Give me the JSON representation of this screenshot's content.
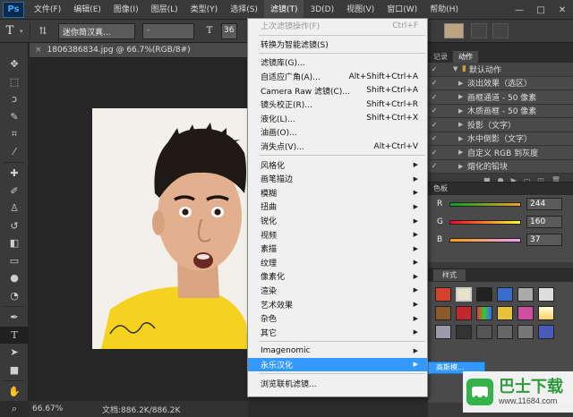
{
  "app": {
    "logo": "Ps"
  },
  "menubar": {
    "items": [
      "文件(F)",
      "编辑(E)",
      "图像(I)",
      "图层(L)",
      "类型(Y)",
      "选择(S)",
      "滤镜(T)",
      "3D(D)",
      "视图(V)",
      "窗口(W)",
      "帮助(H)"
    ],
    "active_index": 6,
    "window_controls": [
      "—",
      "□",
      "✕"
    ]
  },
  "options": {
    "tool_glyph": "T",
    "font_family": "迷你简汉真...",
    "font_style": "-",
    "font_size": "36"
  },
  "toolbar": {
    "tools": [
      "move-tool",
      "marquee-tool",
      "lasso-tool",
      "quick-select-tool",
      "crop-tool",
      "eyedropper-tool",
      "healing-brush-tool",
      "brush-tool",
      "clone-stamp-tool",
      "history-brush-tool",
      "eraser-tool",
      "gradient-tool",
      "blur-tool",
      "dodge-tool",
      "pen-tool",
      "type-tool",
      "path-select-tool",
      "shape-tool",
      "hand-tool",
      "zoom-tool"
    ],
    "active": "type-tool"
  },
  "document": {
    "tab_title": "1806386834.jpg @ 66.7%(RGB/8#)",
    "close_glyph": "×",
    "zoom": "66.67%",
    "info": "文档:886.2K/886.2K"
  },
  "filter_menu": {
    "groups": [
      [
        {
          "label": "上次滤镜操作(F)",
          "shortcut": "Ctrl+F",
          "disabled": true
        }
      ],
      [
        {
          "label": "转换为智能滤镜(S)"
        }
      ],
      [
        {
          "label": "滤镜库(G)..."
        },
        {
          "label": "自适应广角(A)...",
          "shortcut": "Alt+Shift+Ctrl+A"
        },
        {
          "label": "Camera Raw 滤镜(C)...",
          "shortcut": "Shift+Ctrl+A"
        },
        {
          "label": "镜头校正(R)...",
          "shortcut": "Shift+Ctrl+R"
        },
        {
          "label": "液化(L)...",
          "shortcut": "Shift+Ctrl+X"
        },
        {
          "label": "油画(O)..."
        },
        {
          "label": "消失点(V)...",
          "shortcut": "Alt+Ctrl+V"
        }
      ],
      [
        {
          "label": "风格化",
          "submenu": true
        },
        {
          "label": "画笔描边",
          "submenu": true
        },
        {
          "label": "模糊",
          "submenu": true
        },
        {
          "label": "扭曲",
          "submenu": true
        },
        {
          "label": "锐化",
          "submenu": true
        },
        {
          "label": "视频",
          "submenu": true
        },
        {
          "label": "素描",
          "submenu": true
        },
        {
          "label": "纹理",
          "submenu": true
        },
        {
          "label": "像素化",
          "submenu": true
        },
        {
          "label": "渲染",
          "submenu": true
        },
        {
          "label": "艺术效果",
          "submenu": true
        },
        {
          "label": "杂色",
          "submenu": true
        },
        {
          "label": "其它",
          "submenu": true
        }
      ],
      [
        {
          "label": "Imagenomic",
          "submenu": true
        },
        {
          "label": "永乐汉化",
          "submenu": true,
          "highlighted": true
        }
      ],
      [
        {
          "label": "浏览联机滤镜..."
        }
      ]
    ],
    "submenu_peek": "高斯模..."
  },
  "actions_panel": {
    "tabs": [
      "记录",
      "动作"
    ],
    "active_tab": "动作",
    "folder": "默认动作",
    "items": [
      "淡出效果（选区）",
      "画框通道 - 50 像素",
      "木质画框 - 50 像素",
      "投影（文字）",
      "水中倒影（文字）",
      "自定义 RGB 到灰度",
      "熔化的铅块"
    ]
  },
  "color_panel": {
    "tab": "色板",
    "channels": [
      {
        "name": "R",
        "value": "244"
      },
      {
        "name": "G",
        "value": "160"
      },
      {
        "name": "B",
        "value": "37"
      }
    ]
  },
  "styles_panel": {
    "tab": "样式"
  },
  "watermark": {
    "title": "巴士下载",
    "url": "www.11684.com"
  },
  "colors": {
    "highlight": "#3399ff",
    "swatch": "#bba580",
    "photo_shirt": "#f4d21f"
  }
}
